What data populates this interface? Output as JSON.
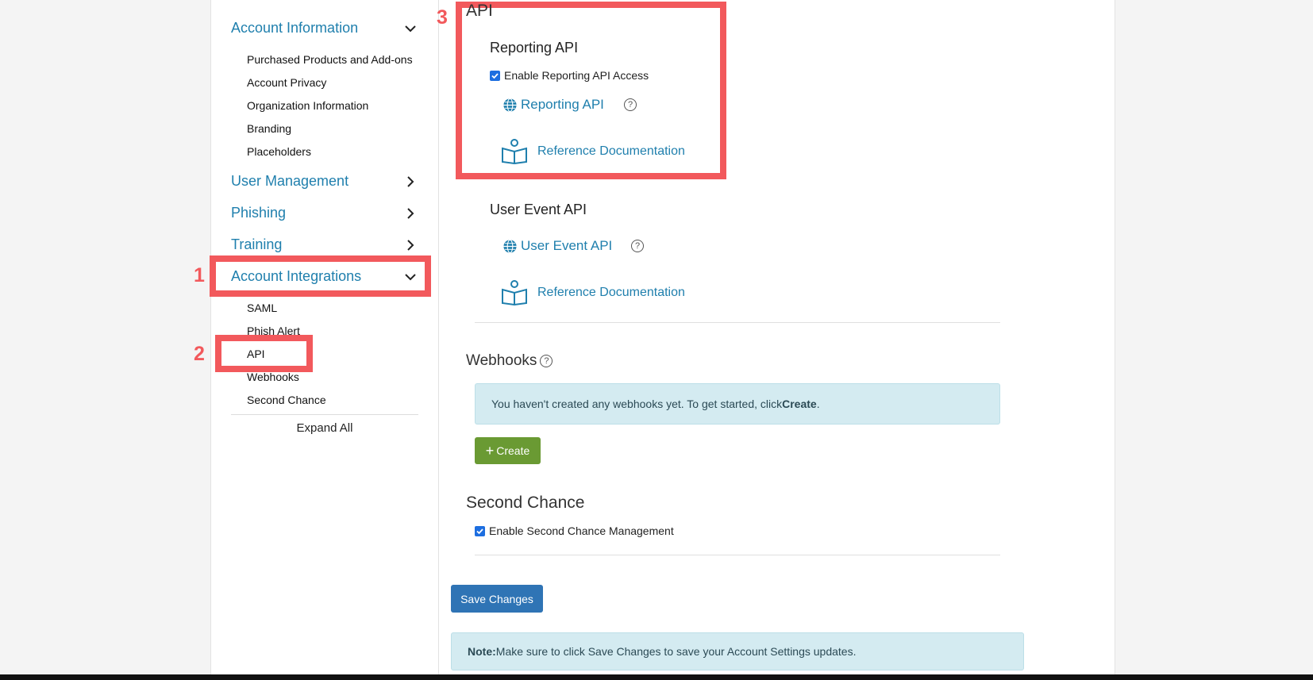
{
  "sidebar": {
    "sections": [
      {
        "label": "Account Information",
        "expanded": true
      },
      {
        "label": "User Management",
        "expanded": false
      },
      {
        "label": "Phishing",
        "expanded": false
      },
      {
        "label": "Training",
        "expanded": false
      },
      {
        "label": "Account Integrations",
        "expanded": true
      }
    ],
    "account_info_items": [
      "Purchased Products and Add-ons",
      "Account Privacy",
      "Organization Information",
      "Branding",
      "Placeholders"
    ],
    "integration_items": [
      "SAML",
      "Phish Alert",
      "API",
      "Webhooks",
      "Second Chance"
    ],
    "expand_all": "Expand All"
  },
  "annotations": [
    "1",
    "2",
    "3"
  ],
  "api": {
    "heading": "API",
    "reporting": {
      "heading": "Reporting API",
      "checkbox_label": "Enable Reporting API Access",
      "checkbox_checked": true,
      "link": "Reporting API",
      "docs": "Reference Documentation"
    },
    "user_event": {
      "heading": "User Event API",
      "link": "User Event API",
      "docs": "Reference Documentation"
    }
  },
  "webhooks": {
    "heading": "Webhooks",
    "empty_text": "You haven't created any webhooks yet. To get started, click ",
    "empty_strong": "Create",
    "empty_end": ".",
    "create_label": "Create"
  },
  "second_chance": {
    "heading": "Second Chance",
    "checkbox_label": "Enable Second Chance Management",
    "checkbox_checked": true
  },
  "save_label": "Save Changes",
  "note": {
    "strong": "Note:",
    "text": " Make sure to click Save Changes to save your Account Settings updates."
  },
  "colors": {
    "link": "#1f7fad",
    "annotation": "#f2595c",
    "create": "#6a9a33",
    "save": "#2f74b5",
    "info_bg": "#d4ebf1"
  },
  "icons": {
    "globe": "globe-icon",
    "book": "open-book-icon",
    "help": "help-circle-icon",
    "chevron_down": "chevron-down-icon",
    "chevron_right": "chevron-right-icon"
  }
}
